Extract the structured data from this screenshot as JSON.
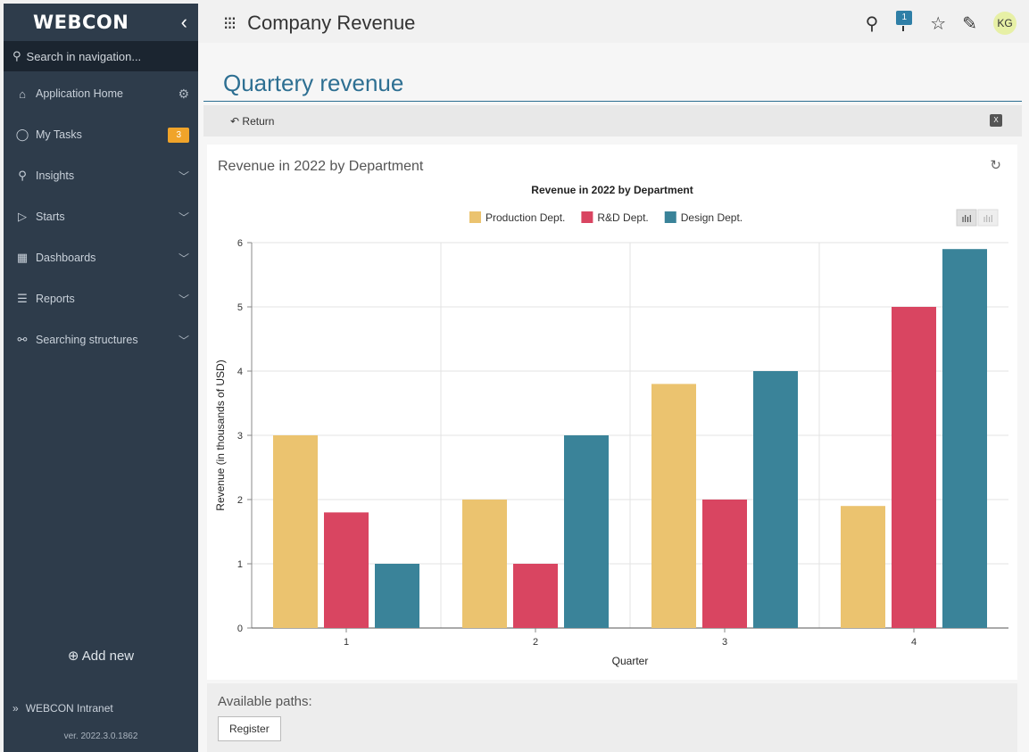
{
  "sidebar": {
    "logo": "WEBCON",
    "collapse_icon": "‹",
    "search_placeholder": "Search in navigation...",
    "items": [
      {
        "label": "Application Home",
        "icon": "⌂"
      },
      {
        "label": "My Tasks",
        "icon": "◯",
        "badge": "3"
      },
      {
        "label": "Insights",
        "icon": "⚲"
      },
      {
        "label": "Starts",
        "icon": "▷"
      },
      {
        "label": "Dashboards",
        "icon": "▦"
      },
      {
        "label": "Reports",
        "icon": "☰"
      },
      {
        "label": "Searching structures",
        "icon": "⚯"
      }
    ],
    "add_new": "Add new",
    "intranet": "WEBCON Intranet",
    "version": "ver. 2022.3.0.1862"
  },
  "topbar": {
    "title": "Company Revenue",
    "notification_count": "1",
    "avatar": "KG"
  },
  "main": {
    "page_title": "Quartery revenue",
    "return_label": "Return",
    "card_title": "Revenue in 2022 by Department",
    "paths_title": "Available paths:",
    "register_label": "Register"
  },
  "colors": {
    "production": "#ebc36f",
    "rnd": "#d94561",
    "design": "#3a8399",
    "accent": "#2d6f92"
  },
  "chart_data": {
    "type": "bar",
    "title": "Revenue in 2022 by Department",
    "xlabel": "Quarter",
    "ylabel": "Revenue (in thousands of USD)",
    "categories": [
      "1",
      "2",
      "3",
      "4"
    ],
    "ylim": [
      0,
      6
    ],
    "yticks": [
      0,
      1,
      2,
      3,
      4,
      5,
      6
    ],
    "legend_position": "top-center",
    "grid": true,
    "series": [
      {
        "name": "Production Dept.",
        "values": [
          3,
          2,
          3.8,
          1.9
        ]
      },
      {
        "name": "R&D Dept.",
        "values": [
          1.8,
          1,
          2,
          5
        ]
      },
      {
        "name": "Design Dept.",
        "values": [
          1,
          3,
          4,
          5.9
        ]
      }
    ]
  }
}
